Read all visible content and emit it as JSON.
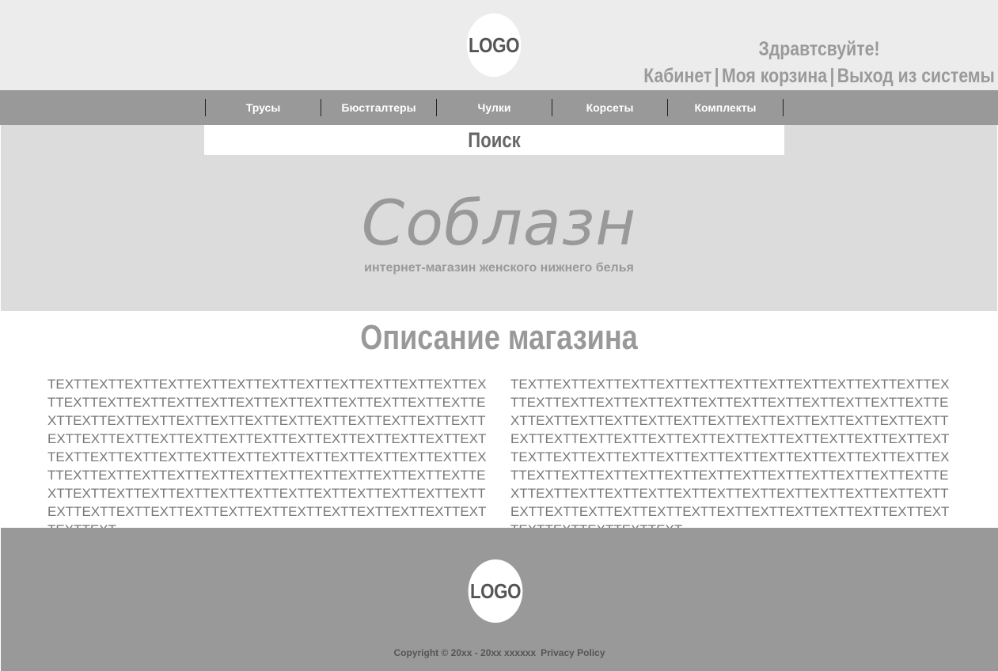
{
  "header": {
    "logo_text": "LOGO",
    "greeting": "Здравтсвуйте!",
    "links": {
      "cabinet": "Кабинет",
      "separator": "|",
      "cart": "Моя корзина",
      "logout": "Выход из системы"
    }
  },
  "nav": {
    "items": [
      {
        "label": "Трусы"
      },
      {
        "label": "Бюстгалтеры"
      },
      {
        "label": "Чулки"
      },
      {
        "label": "Корсеты"
      },
      {
        "label": "Комплекты"
      }
    ]
  },
  "banner": {
    "search_label": "Поиск",
    "brand": "Соблазн",
    "tagline": "интернет-магазин женского нижнего белья"
  },
  "content": {
    "title": "Описание магазина",
    "left_text": "TEXTTEXTTEXTTEXTTEXTTEXTTEXTTEXTTEXTTEXTTEXTTEXTTEXTTEXTTEXTTEXTTEXTTEXTTEXTTEXTTEXTTEXTTEXTTEXTTEXTTEXTTEXTTEXTTEXTTEXTTEXTTEXTTEXTTEXTTEXTTEXTTEXTTEXTTEXTTEXTTEXTTEXTTEXTTEXTTEXTTEXTTEXTTEXTTEXTTEXTTEXTTEXTTEXTTEXTTEXTTEXTTEXTTEXTTEXTTEXTTEXTTEXTTEXTTEXTTEXTTEXTTEXTTEXTTEXTTEXTTEXTTEXTTEXTTEXTTEXTTEXTTEXTTEXTTEXTTEXTTEXTTEXTTEXTTEXTTEXTTEXTTEXTTEXTTEXTTEXTTEXTTEXTTEXTTEXTTEXTTEXTTEXTTEXTTEXTTEXTTEXTTEXTTEXTTEXT",
    "right_text": "TEXTTEXTTEXTTEXTTEXTTEXTTEXTTEXTTEXTTEXTTEXTTEXTTEXTTEXTTEXTTEXTTEXTTEXTTEXTTEXTTEXTTEXTTEXTTEXTTEXTTEXTTEXTTEXTTEXTTEXTTEXTTEXTTEXTTEXTTEXTTEXTTEXTTEXTTEXTTEXTTEXTTEXTTEXTTEXTTEXTTEXTTEXTTEXTTEXTTEXTTEXTTEXTTEXTTEXTTEXTTEXTTEXTTEXTTEXTTEXTTEXTTEXTTEXTTEXTTEXTTEXTTEXTTEXTTEXTTEXTTEXTTEXTTEXTTEXTTEXTTEXTTEXTTEXTTEXTTEXTTEXTTEXTTEXTTEXTTEXTTEXTTEXTTEXTTEXTTEXTTEXTTEXTTEXTTEXTTEXTTEXTTEXTTEXTTEXTTEXTTEXTTEXTTEXTTEXTTEXTTEXTTEXT"
  },
  "footer": {
    "logo_text": "LOGO",
    "copyright": "Copyright © 20xx - 20xx xxxxxx",
    "privacy": "Privacy Policy"
  },
  "colors": {
    "header_bg": "#ececec",
    "nav_bg": "#999999",
    "banner_bg": "#dcdcdc",
    "footer_bg": "#999999",
    "accent_text": "#999999"
  }
}
